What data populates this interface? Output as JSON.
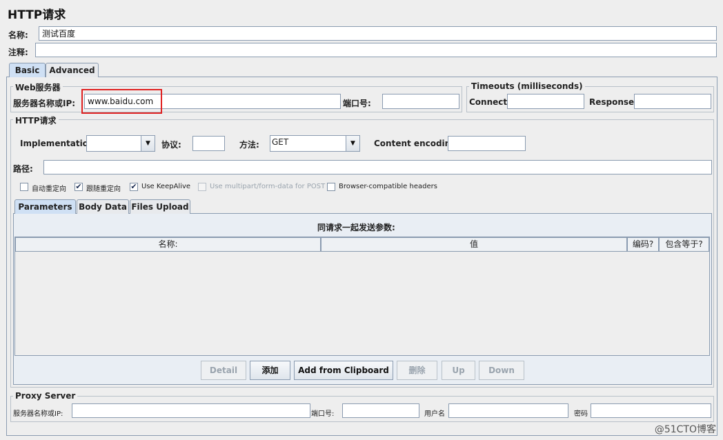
{
  "page": {
    "title": "HTTP请求"
  },
  "form": {
    "name_label": "名称:",
    "name_value": "测试百度",
    "comment_label": "注释:",
    "comment_value": ""
  },
  "tabs": [
    {
      "label": "Basic",
      "active": true
    },
    {
      "label": "Advanced",
      "active": false
    }
  ],
  "web_server": {
    "title": "Web服务器",
    "server_label": "服务器名称或IP:",
    "server_value": "www.baidu.com",
    "port_label": "端口号:",
    "port_value": ""
  },
  "timeouts": {
    "title": "Timeouts (milliseconds)",
    "connect_label": "Connect:",
    "connect_value": "",
    "response_label": "Response:",
    "response_value": ""
  },
  "http_request": {
    "title": "HTTP请求",
    "implementation_label": "Implementation:",
    "implementation_value": "",
    "protocol_label": "协议:",
    "protocol_value": "",
    "method_label": "方法:",
    "method_value": "GET",
    "encoding_label": "Content encoding:",
    "encoding_value": "",
    "path_label": "路径:",
    "path_value": ""
  },
  "checkboxes": [
    {
      "label": "自动重定向",
      "checked": false,
      "disabled": false
    },
    {
      "label": "跟随重定向",
      "checked": true,
      "disabled": false
    },
    {
      "label": "Use KeepAlive",
      "checked": true,
      "disabled": false
    },
    {
      "label": "Use multipart/form-data for POST",
      "checked": false,
      "disabled": true
    },
    {
      "label": "Browser-compatible headers",
      "checked": false,
      "disabled": false
    }
  ],
  "param_tabs": [
    {
      "label": "Parameters",
      "active": true
    },
    {
      "label": "Body Data",
      "active": false
    },
    {
      "label": "Files Upload",
      "active": false
    }
  ],
  "params": {
    "heading": "同请求一起发送参数:",
    "columns": [
      "名称:",
      "值",
      "编码?",
      "包含等于?"
    ],
    "rows": []
  },
  "buttons": {
    "detail": "Detail",
    "add": "添加",
    "add_clipboard": "Add from Clipboard",
    "delete": "删除",
    "up": "Up",
    "down": "Down"
  },
  "proxy": {
    "title": "Proxy Server",
    "server_label": "服务器名称或IP:",
    "server_value": "",
    "port_label": "端口号:",
    "port_value": "",
    "user_label": "用户名",
    "user_value": "",
    "password_label": "密码",
    "password_value": ""
  },
  "watermark": "@51CTO博客",
  "colors": {
    "highlight": "#e02020",
    "active_tab": "#cfe0f4",
    "background": "#eeeeee"
  }
}
